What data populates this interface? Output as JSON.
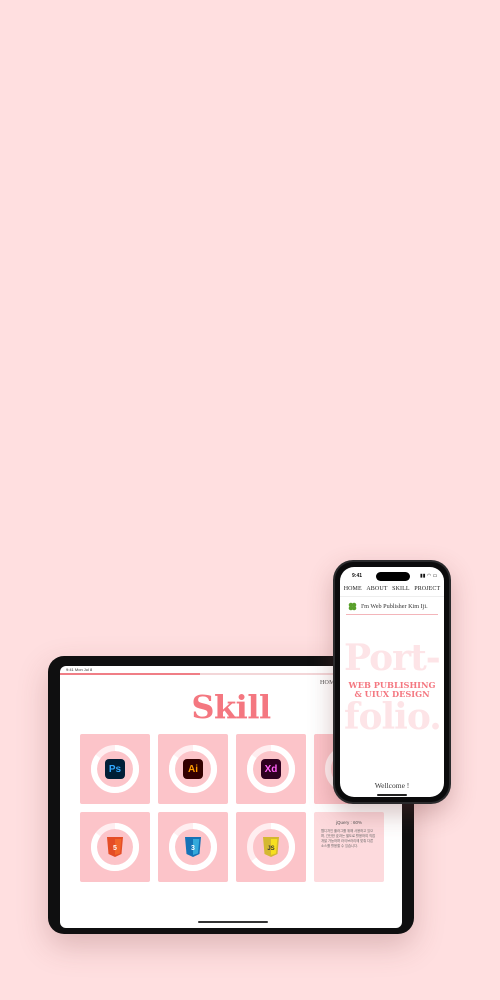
{
  "tablet": {
    "status_text": "9:41 Mon Jul 8",
    "scroll_progress": 0.41,
    "section_title": "Skill",
    "nav": [
      "HOME",
      "AB"
    ],
    "skills": [
      {
        "name": "Photoshop",
        "icon": "ps-icon",
        "badge": "Ps",
        "percent": 0.85
      },
      {
        "name": "Illustrator",
        "icon": "ai-icon",
        "badge": "Ai",
        "percent": 0.85
      },
      {
        "name": "XD",
        "icon": "xd-icon",
        "badge": "Xd",
        "percent": 0.85
      },
      {
        "name": "HTML5",
        "icon": "html5-icon",
        "badge": "HTML",
        "percent": 0.85
      },
      {
        "name": "CSS3",
        "icon": "css3-icon",
        "badge": "CSS",
        "percent": 0.85
      },
      {
        "name": "JavaScript",
        "icon": "js-icon",
        "badge": "JS",
        "percent": 0.65
      }
    ],
    "detail_card": {
      "title": "jQuery : 60%",
      "text": "웹디자인 플러그를 위해 사용하고 있으며, 간단한 효과는 별도로 활용하여 직접 개발 가능하며 라이브러리에 맞춰 다른 소스를 활용할 수 있습니다."
    },
    "colors": {
      "accent": "#f47780",
      "card": "#fcc4c9"
    }
  },
  "phone": {
    "time": "9:41",
    "status_icons": "▮▮ ◠ ▭",
    "nav": [
      "HOME",
      "ABOUT",
      "SKILL",
      "PROJECT"
    ],
    "intro_icon": "clover-icon",
    "intro": "I'm Web Publisher Kim Iji.",
    "big_line1": "Port-",
    "big_line2": "folio.",
    "sub_line1": "WEB PUBLISHING",
    "sub_line2": "& UIUX DESIGN",
    "welcome": "Wellcome !"
  }
}
